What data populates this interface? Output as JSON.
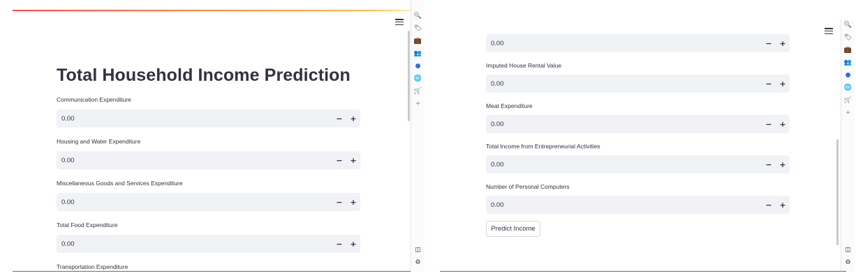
{
  "left": {
    "title": "Total Household Income Prediction",
    "fields": [
      {
        "label": "Communication Expenditure",
        "value": "0.00"
      },
      {
        "label": "Housing and Water Expenditure",
        "value": "0.00"
      },
      {
        "label": "Miscellaneous Goods and Services Expenditure",
        "value": "0.00"
      },
      {
        "label": "Total Food Expenditure",
        "value": "0.00"
      }
    ],
    "cut_label": "Transportation Expenditure"
  },
  "right": {
    "top_value": "0.00",
    "fields": [
      {
        "label": "Imputed House Rental Value",
        "value": "0.00"
      },
      {
        "label": "Meat Expenditure",
        "value": "0.00"
      },
      {
        "label": "Total Income from Entrepreneurial Activities",
        "value": "0.00"
      },
      {
        "label": "Number of Personal Computers",
        "value": "0.00"
      }
    ],
    "button_label": "Predict Income"
  },
  "stepper": {
    "minus": "−",
    "plus": "+"
  },
  "colors": {
    "accent_start": "#ff4b4b",
    "accent_end": "#ffbd45",
    "input_bg": "#f0f2f6",
    "text": "#31333f"
  },
  "sidebar_icons": {
    "top": [
      {
        "name": "search-icon",
        "glyph": "🔍"
      },
      {
        "name": "tag-icon",
        "glyph": "🏷"
      },
      {
        "name": "briefcase-icon",
        "glyph": "💼"
      },
      {
        "name": "people-icon",
        "glyph": "👥"
      },
      {
        "name": "circle-icon",
        "glyph": "●"
      },
      {
        "name": "globe-icon",
        "glyph": "🌐"
      },
      {
        "name": "cart-icon",
        "glyph": "🛒"
      },
      {
        "name": "add-icon",
        "glyph": "+"
      }
    ],
    "bottom": [
      {
        "name": "panel-icon",
        "glyph": "◫"
      },
      {
        "name": "settings-icon",
        "glyph": "⚙"
      }
    ]
  }
}
